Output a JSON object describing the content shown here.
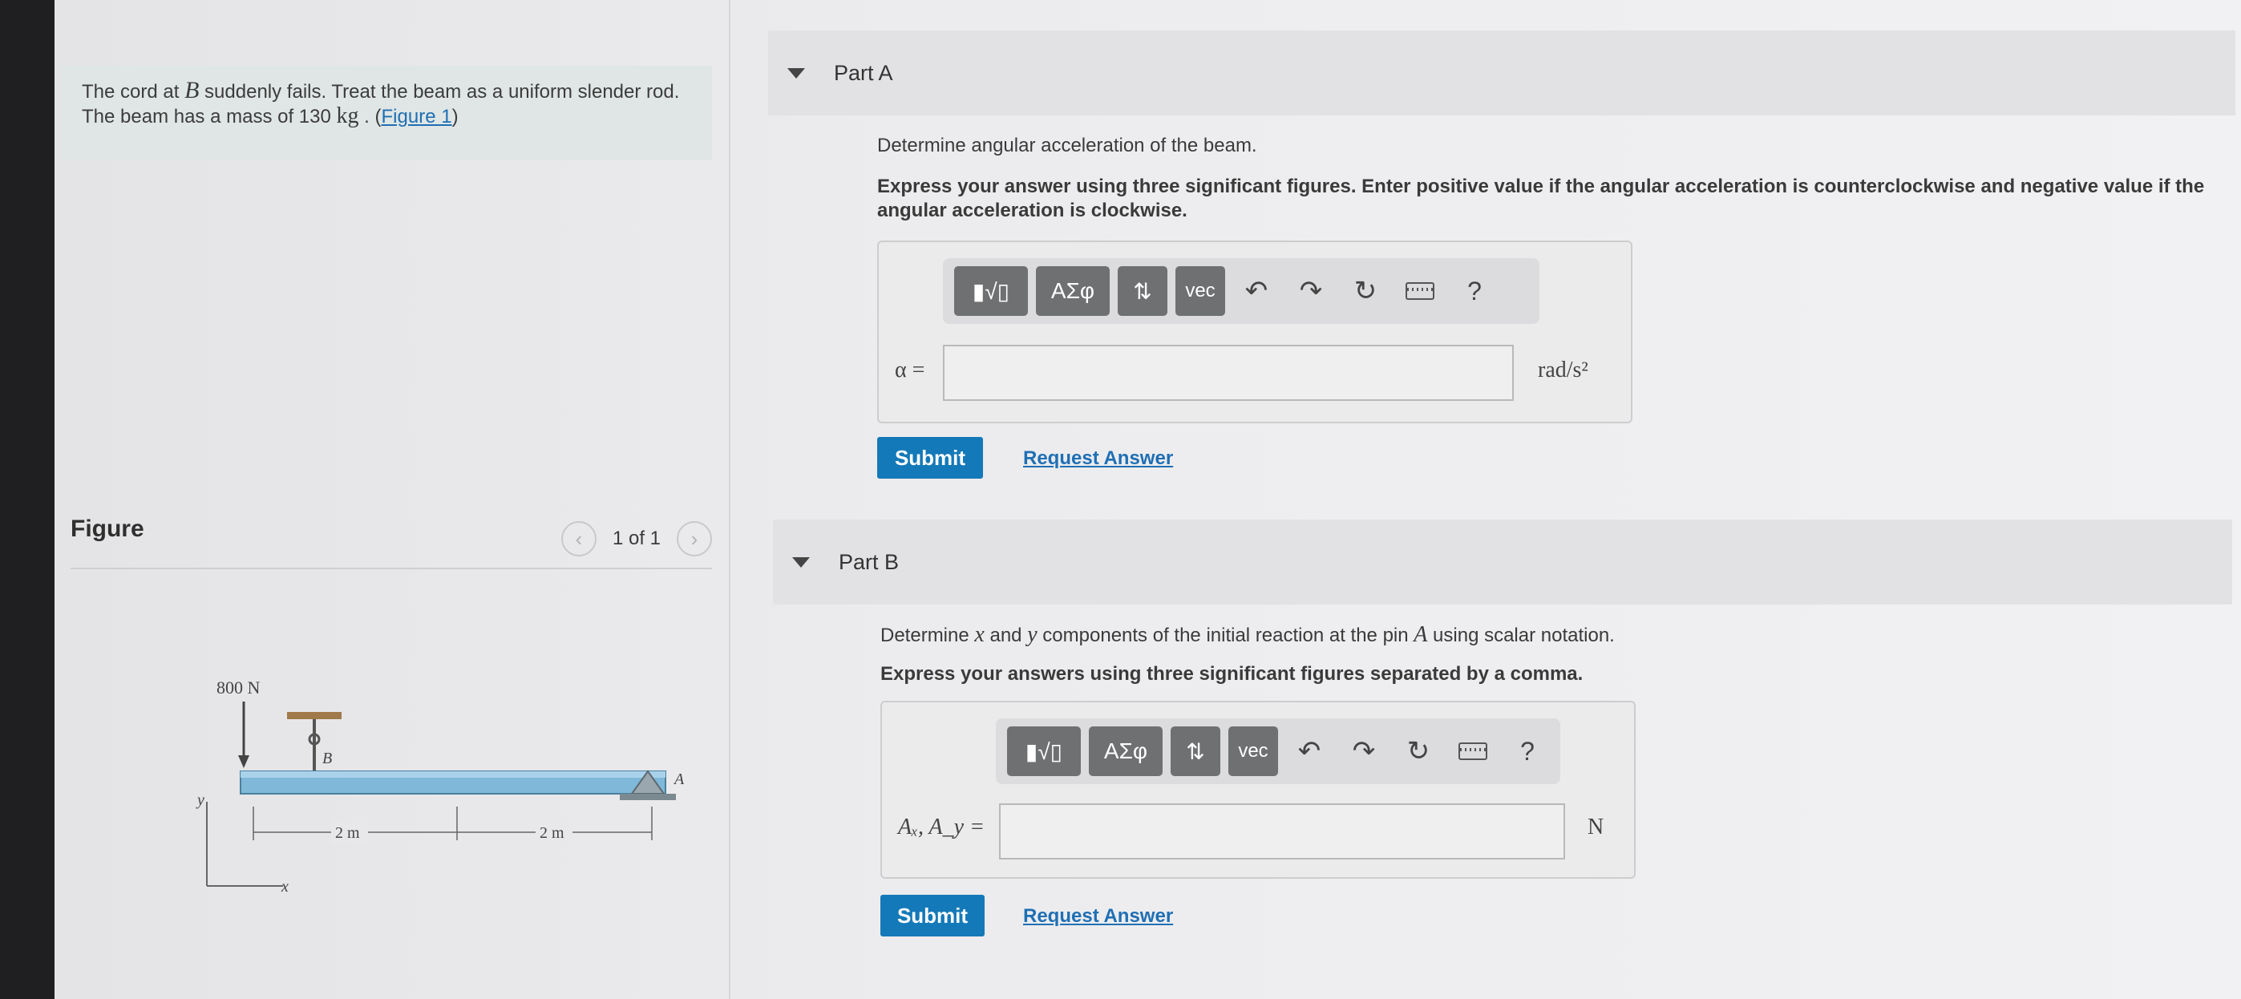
{
  "problem": {
    "text_a": "The cord at ",
    "var_b": "B",
    "text_b": " suddenly fails. Treat the beam as a uniform slender rod. The beam has a mass of 130 ",
    "unit": "kg",
    "text_c": " . (",
    "figure_link": "Figure 1",
    "text_d": ")"
  },
  "figure": {
    "title": "Figure",
    "pager_text": "1 of 1",
    "prev_icon": "chevron-left-icon",
    "next_icon": "chevron-right-icon",
    "force_label": "800 N",
    "label_b": "B",
    "label_a": "A",
    "dim1": "2 m",
    "dim2": "2 m",
    "axis_y": "y",
    "axis_x": "x"
  },
  "parts": [
    {
      "title": "Part A",
      "prompt": "Determine angular acceleration of the beam.",
      "instructions": "Express your answer using three significant figures. Enter positive value if the angular acceleration is counterclockwise and negative value if the angular acceleration is clockwise.",
      "answer_label": "α =",
      "answer_value": "",
      "unit": "rad/s²",
      "submit": "Submit",
      "request": "Request Answer"
    },
    {
      "title": "Part B",
      "prompt_1": "Determine ",
      "prompt_x": "x",
      "prompt_2": " and ",
      "prompt_y": "y",
      "prompt_3": " components of the initial reaction at the pin ",
      "prompt_a": "A",
      "prompt_4": " using scalar notation.",
      "instructions": "Express your answers using three significant figures separated by a comma.",
      "answer_label": "Aₓ, A_y =",
      "answer_value": "",
      "unit": "N",
      "submit": "Submit",
      "request": "Request Answer"
    }
  ],
  "toolbar": {
    "templates": "▮√▯",
    "greek": "ΑΣφ",
    "arrows": "⇅",
    "vec": "vec",
    "undo_icon": "undo-icon",
    "redo_icon": "redo-icon",
    "reset_icon": "reset-icon",
    "keyboard_icon": "keyboard-icon",
    "help": "?"
  }
}
